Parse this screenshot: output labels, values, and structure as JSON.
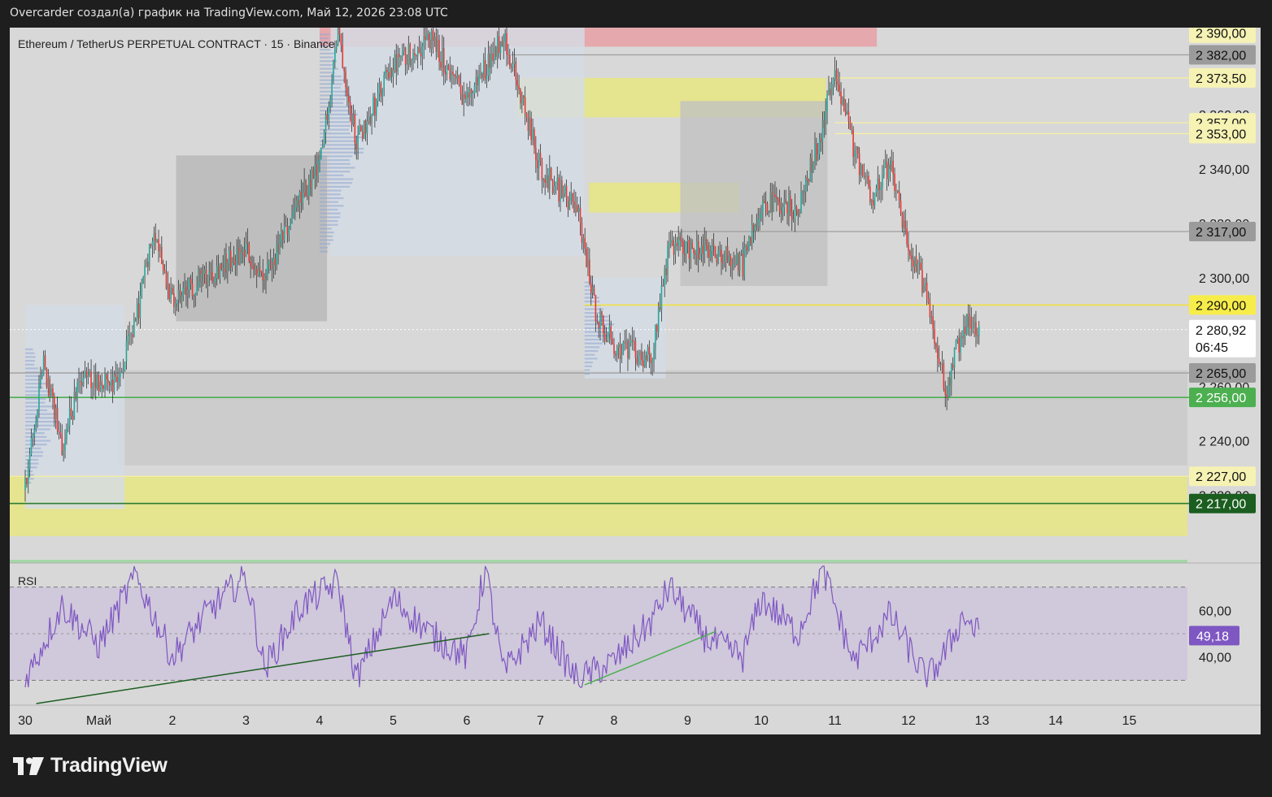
{
  "header": {
    "snapshot_text": "Overcarder создал(а) график на TradingView.com, Май 12, 2026 23:08 UTC"
  },
  "chart_title": "Ethereum / TetherUS PERPETUAL CONTRACT · 15 · Binance",
  "footer": {
    "brand": "TradingView",
    "logo_icon": "tradingview-logo-icon"
  },
  "colors": {
    "up": "#26a69a",
    "down": "#e53935",
    "rsi": "#7e57c2",
    "highlight_yellow": "#e8e682",
    "zone_red": "#e8a0a6",
    "green_line": "#4caf50",
    "dark_green": "#1b5e20"
  },
  "chart_data": [
    {
      "type": "candlestick",
      "title": "Ethereum / TetherUS PERPETUAL CONTRACT · 15 · Binance",
      "x_ticks": [
        "30",
        "Май",
        "2",
        "3",
        "4",
        "5",
        "6",
        "7",
        "8",
        "9",
        "10",
        "11",
        "12",
        "13",
        "14",
        "15"
      ],
      "y_ticks": [
        "2 390,00",
        "2 360,00",
        "2 340,00",
        "2 320,00",
        "2 300,00",
        "2 280,00",
        "2 260,00",
        "2 240,00",
        "2 220,00"
      ],
      "ylim": [
        2196,
        2392
      ],
      "price_path_daily": [
        {
          "day": "30 Apr 00:00",
          "price": 2222
        },
        {
          "day": "30 Apr 06:00",
          "price": 2268
        },
        {
          "day": "30 Apr 12:00",
          "price": 2238
        },
        {
          "day": "30 Apr 18:00",
          "price": 2262
        },
        {
          "day": "1 May 06:00",
          "price": 2262
        },
        {
          "day": "1 May 12:00",
          "price": 2283
        },
        {
          "day": "1 May 18:00",
          "price": 2320
        },
        {
          "day": "2 May 00:00",
          "price": 2290
        },
        {
          "day": "2 May 12:00",
          "price": 2302
        },
        {
          "day": "3 May 00:00",
          "price": 2310
        },
        {
          "day": "3 May 06:00",
          "price": 2298
        },
        {
          "day": "3 May 18:00",
          "price": 2330
        },
        {
          "day": "4 May 00:00",
          "price": 2340
        },
        {
          "day": "4 May 06:00",
          "price": 2392
        },
        {
          "day": "4 May 12:00",
          "price": 2350
        },
        {
          "day": "5 May 00:00",
          "price": 2378
        },
        {
          "day": "5 May 12:00",
          "price": 2388
        },
        {
          "day": "6 May 00:00",
          "price": 2365
        },
        {
          "day": "6 May 12:00",
          "price": 2390
        },
        {
          "day": "7 May 00:00",
          "price": 2340
        },
        {
          "day": "7 May 12:00",
          "price": 2325
        },
        {
          "day": "7 May 18:00",
          "price": 2288
        },
        {
          "day": "8 May 00:00",
          "price": 2275
        },
        {
          "day": "8 May 12:00",
          "price": 2270
        },
        {
          "day": "8 May 18:00",
          "price": 2312
        },
        {
          "day": "9 May 06:00",
          "price": 2310
        },
        {
          "day": "9 May 18:00",
          "price": 2305
        },
        {
          "day": "10 May 00:00",
          "price": 2328
        },
        {
          "day": "10 May 12:00",
          "price": 2325
        },
        {
          "day": "10 May 20:00",
          "price": 2355
        },
        {
          "day": "11 May 00:00",
          "price": 2378
        },
        {
          "day": "11 May 06:00",
          "price": 2348
        },
        {
          "day": "11 May 12:00",
          "price": 2330
        },
        {
          "day": "11 May 18:00",
          "price": 2342
        },
        {
          "day": "12 May 00:00",
          "price": 2310
        },
        {
          "day": "12 May 06:00",
          "price": 2295
        },
        {
          "day": "12 May 12:00",
          "price": 2258
        },
        {
          "day": "12 May 18:00",
          "price": 2283
        },
        {
          "day": "12 May 23:08",
          "price": 2281
        }
      ],
      "price_labels": [
        {
          "value": "2 390,00",
          "kind": "yellow"
        },
        {
          "value": "2 382,00",
          "kind": "gray"
        },
        {
          "value": "2 373,50",
          "kind": "yellow"
        },
        {
          "value": "2 357,00",
          "kind": "yellow"
        },
        {
          "value": "2 353,00",
          "kind": "yellow"
        },
        {
          "value": "2 317,00",
          "kind": "gray"
        },
        {
          "value": "2 290,00",
          "kind": "yellowbold"
        },
        {
          "value": "2 265,00",
          "kind": "gray"
        },
        {
          "value": "2 256,00",
          "kind": "green"
        },
        {
          "value": "2 227,00",
          "kind": "yellow"
        },
        {
          "value": "2 217,00",
          "kind": "darkgreen"
        }
      ],
      "horizontal_levels": [
        {
          "price": 2382,
          "color": "#9e9e9e"
        },
        {
          "price": 2373.5,
          "color": "#f5f0a0"
        },
        {
          "price": 2357,
          "color": "#f5f0a0"
        },
        {
          "price": 2353,
          "color": "#f5f0a0"
        },
        {
          "price": 2317,
          "color": "#9e9e9e"
        },
        {
          "price": 2290,
          "color": "#f0e040"
        },
        {
          "price": 2265,
          "color": "#9e9e9e"
        },
        {
          "price": 2256,
          "color": "#4caf50"
        },
        {
          "price": 2227,
          "color": "#f5f0a0"
        },
        {
          "price": 2217,
          "color": "#2e7d32"
        }
      ],
      "zones": [
        {
          "kind": "yellow",
          "price_top": 2227,
          "price_bottom": 2205
        },
        {
          "kind": "gray",
          "price_top": 2266,
          "price_bottom": 2231
        },
        {
          "kind": "yellow",
          "price_top": 2373.5,
          "price_bottom": 2359
        },
        {
          "kind": "yellow",
          "price_top": 2335,
          "price_bottom": 2324
        },
        {
          "kind": "red",
          "price_top": 2392,
          "price_bottom": 2385
        }
      ],
      "current_price": {
        "value": "2 280,92",
        "countdown": "06:45"
      }
    },
    {
      "type": "line",
      "title": "RSI",
      "y_ticks": [
        "60,00",
        "40,00"
      ],
      "bands": [
        70,
        30
      ],
      "middle": 50,
      "current_value": "49,18",
      "ylim": [
        20,
        80
      ],
      "rsi_path": [
        {
          "day": "30 Apr 00:00",
          "value": 30
        },
        {
          "day": "30 Apr 12:00",
          "value": 62
        },
        {
          "day": "1 May 00:00",
          "value": 45
        },
        {
          "day": "1 May 12:00",
          "value": 75
        },
        {
          "day": "2 May 00:00",
          "value": 40
        },
        {
          "day": "2 May 12:00",
          "value": 60
        },
        {
          "day": "3 May 00:00",
          "value": 75
        },
        {
          "day": "3 May 06:00",
          "value": 35
        },
        {
          "day": "3 May 18:00",
          "value": 62
        },
        {
          "day": "4 May 06:00",
          "value": 72
        },
        {
          "day": "4 May 12:00",
          "value": 30
        },
        {
          "day": "5 May 00:00",
          "value": 65
        },
        {
          "day": "5 May 12:00",
          "value": 50
        },
        {
          "day": "6 May 00:00",
          "value": 40
        },
        {
          "day": "6 May 06:00",
          "value": 78
        },
        {
          "day": "6 May 12:00",
          "value": 33
        },
        {
          "day": "7 May 00:00",
          "value": 55
        },
        {
          "day": "7 May 12:00",
          "value": 30
        },
        {
          "day": "8 May 00:00",
          "value": 38
        },
        {
          "day": "8 May 12:00",
          "value": 55
        },
        {
          "day": "8 May 18:00",
          "value": 70
        },
        {
          "day": "9 May 06:00",
          "value": 48
        },
        {
          "day": "9 May 18:00",
          "value": 40
        },
        {
          "day": "10 May 00:00",
          "value": 65
        },
        {
          "day": "10 May 12:00",
          "value": 50
        },
        {
          "day": "10 May 20:00",
          "value": 78
        },
        {
          "day": "11 May 06:00",
          "value": 38
        },
        {
          "day": "11 May 18:00",
          "value": 58
        },
        {
          "day": "12 May 06:00",
          "value": 30
        },
        {
          "day": "12 May 12:00",
          "value": 42
        },
        {
          "day": "12 May 18:00",
          "value": 58
        },
        {
          "day": "12 May 23:08",
          "value": 49.18
        }
      ]
    }
  ]
}
